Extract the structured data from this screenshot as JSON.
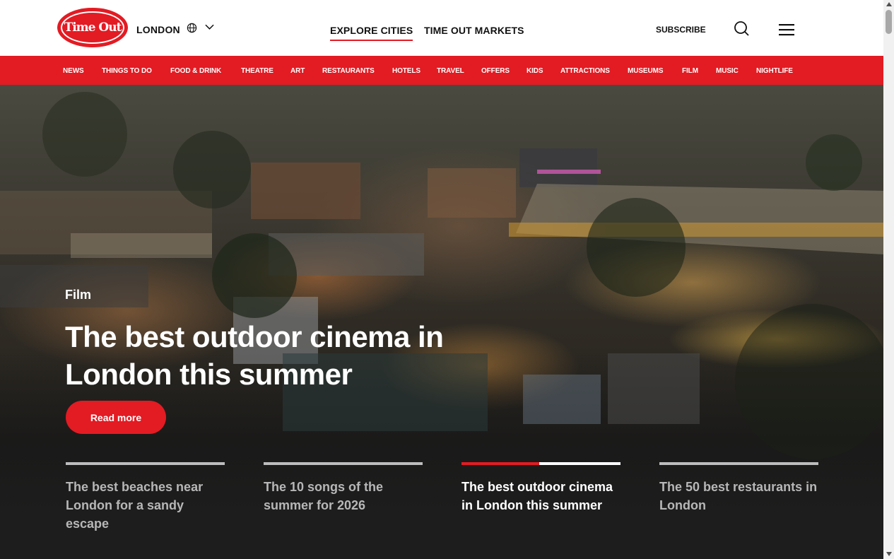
{
  "brand": {
    "logo_text": "Time Out",
    "accent": "#e31b23"
  },
  "header": {
    "city": "LONDON",
    "top_nav": [
      "EXPLORE CITIES",
      "TIME OUT MARKETS"
    ],
    "subscribe": "SUBSCRIBE",
    "icons": [
      "globe-icon",
      "chevron-down-icon",
      "search-icon",
      "menu-icon"
    ]
  },
  "categories": [
    "NEWS",
    "THINGS TO DO",
    "FOOD & DRINK",
    "THEATRE",
    "ART",
    "RESTAURANTS",
    "HOTELS",
    "TRAVEL",
    "OFFERS",
    "KIDS",
    "ATTRACTIONS",
    "MUSEUMS",
    "FILM",
    "MUSIC",
    "NIGHTLIFE"
  ],
  "hero": {
    "tag": "Film",
    "title": "The best outdoor cinema in London this summer",
    "button": "Read more"
  },
  "stories": [
    {
      "title": "The best beaches near London for a sandy escape",
      "active": false
    },
    {
      "title": "The 10 songs of the summer for 2026",
      "active": false
    },
    {
      "title": "The best outdoor cinema in London this summer",
      "active": true,
      "progress": 0.49
    },
    {
      "title": "The 50 best restaurants in London",
      "active": false
    }
  ]
}
